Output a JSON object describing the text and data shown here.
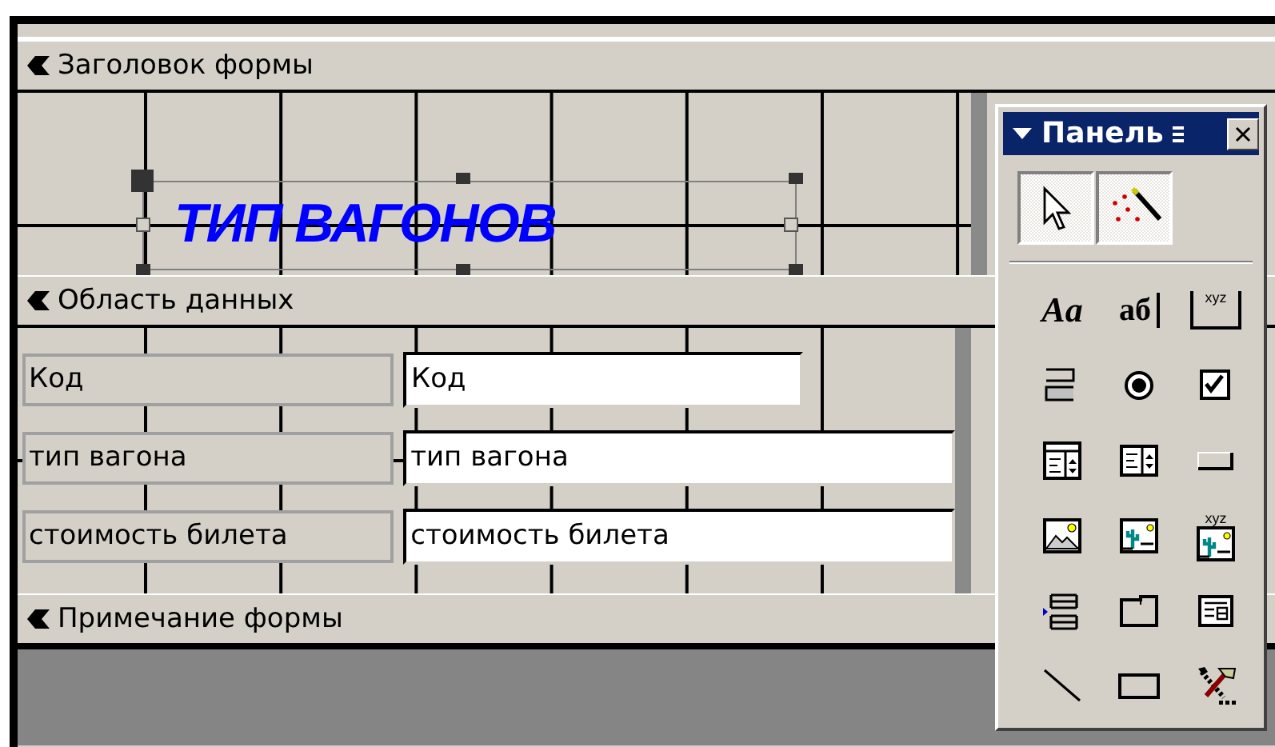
{
  "sections": [
    {
      "kind": "header",
      "title": "Заголовок формы",
      "controls": [
        {
          "kind": "title",
          "text": "ТИП ВАГОНОВ",
          "selected": true
        }
      ]
    },
    {
      "kind": "detail",
      "title": "Область данных",
      "controls": [
        {
          "kind": "field",
          "label": "Код",
          "value": "Код",
          "short": true
        },
        {
          "kind": "field",
          "label": "тип вагона",
          "value": "тип вагона",
          "short": false
        },
        {
          "kind": "field",
          "label": "стоимость билета",
          "value": "стоимость билета",
          "short": false
        }
      ]
    },
    {
      "kind": "footer",
      "title": "Примечание формы"
    }
  ],
  "toolbox": {
    "title": "Панель",
    "modes": [
      {
        "kind": "pointer",
        "selected": true
      },
      {
        "kind": "wizard",
        "selected": true
      }
    ],
    "tools": [
      {
        "kind": "label",
        "glyph": "Aa"
      },
      {
        "kind": "textbox",
        "glyph": "аб"
      },
      {
        "kind": "group",
        "glyph": "xyz"
      },
      {
        "kind": "toggle"
      },
      {
        "kind": "radio"
      },
      {
        "kind": "checkbox"
      },
      {
        "kind": "combo"
      },
      {
        "kind": "list"
      },
      {
        "kind": "button"
      },
      {
        "kind": "image"
      },
      {
        "kind": "unbound"
      },
      {
        "kind": "bound",
        "glyph": "xyz"
      },
      {
        "kind": "pagebreak"
      },
      {
        "kind": "tab"
      },
      {
        "kind": "subform"
      },
      {
        "kind": "line"
      },
      {
        "kind": "rect"
      },
      {
        "kind": "more"
      }
    ]
  }
}
